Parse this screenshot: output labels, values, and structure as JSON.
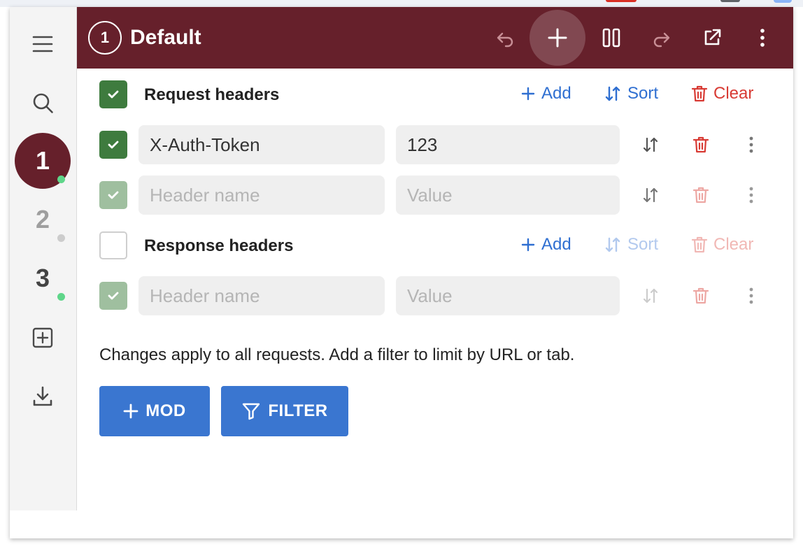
{
  "profile": {
    "number": "1",
    "name": "Default"
  },
  "sidebar": {
    "menu_icon": "hamburger-icon",
    "search_icon": "search-icon",
    "profiles": [
      {
        "label": "1",
        "active": true,
        "dot": "#5fd68a"
      },
      {
        "label": "2",
        "active": false,
        "dot": "#cccccc"
      },
      {
        "label": "3",
        "active": false,
        "dot": "#5fd68a"
      }
    ],
    "add_icon": "add-box-icon",
    "download_icon": "download-icon"
  },
  "toolbar": {
    "undo_icon": "undo-icon",
    "add_icon": "plus-icon",
    "pause_icon": "pause-icon",
    "redo_icon": "redo-icon",
    "open_icon": "open-external-icon",
    "more_icon": "more-vertical-icon"
  },
  "request_headers": {
    "title": "Request headers",
    "add_label": "Add",
    "sort_label": "Sort",
    "clear_label": "Clear",
    "rows": [
      {
        "name": "X-Auth-Token",
        "value": "123",
        "enabled": true
      },
      {
        "name_placeholder": "Header name",
        "value_placeholder": "Value",
        "enabled": true
      }
    ]
  },
  "response_headers": {
    "title": "Response headers",
    "add_label": "Add",
    "sort_label": "Sort",
    "clear_label": "Clear",
    "rows": [
      {
        "name_placeholder": "Header name",
        "value_placeholder": "Value",
        "enabled": true
      }
    ]
  },
  "note": "Changes apply to all requests. Add a filter to limit by URL or tab.",
  "buttons": {
    "mod_label": "MOD",
    "filter_label": "FILTER"
  },
  "colors": {
    "brand": "#66202b",
    "accent": "#3a76d0",
    "checkbox": "#3e7b3e",
    "danger": "#d83b34"
  }
}
